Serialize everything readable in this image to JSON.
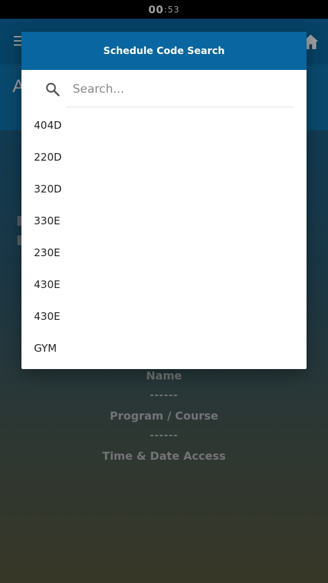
{
  "status_bar": {
    "hours": "00",
    "minutes": ":53"
  },
  "background": {
    "band_text": "A",
    "info_lines": [
      "Name",
      "------",
      "Program / Course",
      "------",
      "Time & Date Access"
    ]
  },
  "dialog": {
    "title": "Schedule Code Search",
    "search_placeholder": "Search...",
    "search_value": "",
    "items": [
      "404D",
      "220D",
      "320D",
      "330E",
      "230E",
      "430E",
      "430E",
      "GYM"
    ]
  },
  "colors": {
    "header_blue": "#0966a0",
    "app_header_blue": "#0b6ba4",
    "text_dark": "#222222"
  }
}
